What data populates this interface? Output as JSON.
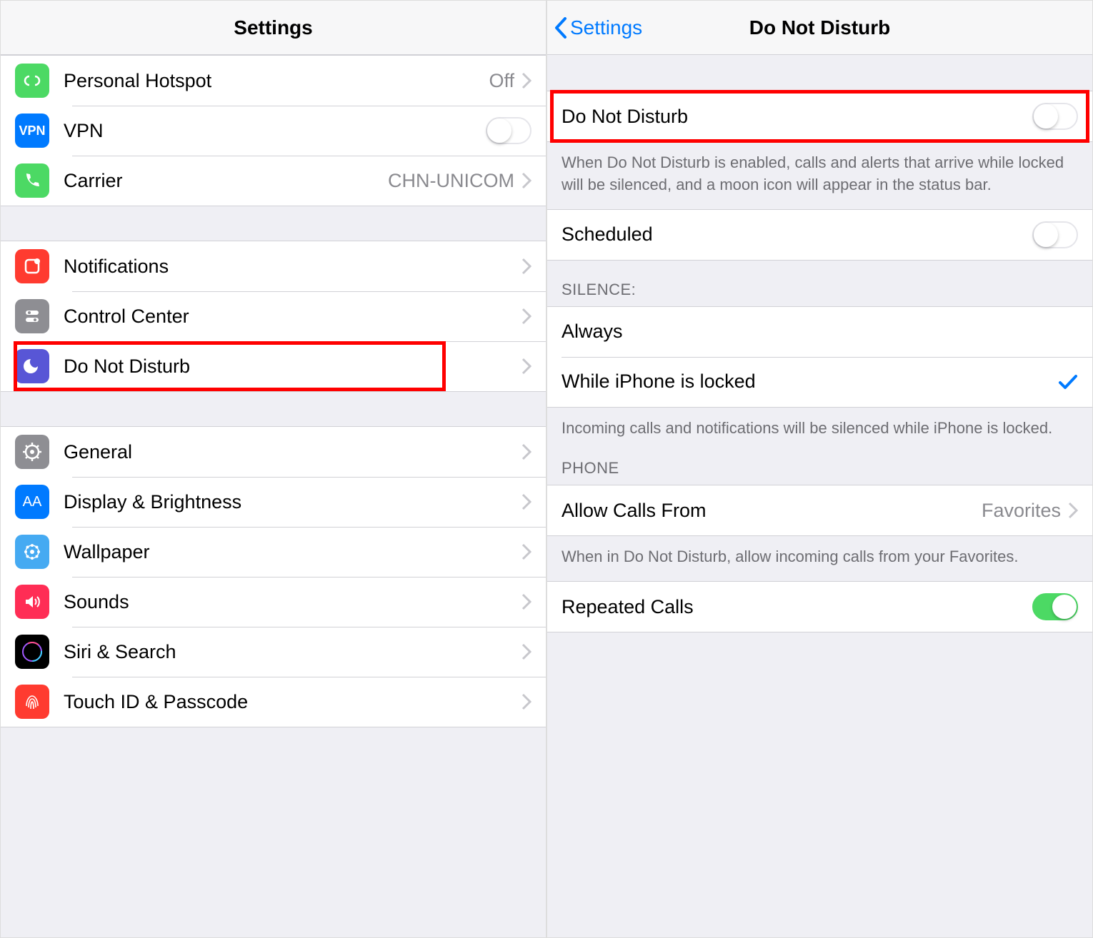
{
  "left": {
    "title": "Settings",
    "rows": {
      "hotspot": {
        "label": "Personal Hotspot",
        "value": "Off"
      },
      "vpn": {
        "label": "VPN"
      },
      "carrier": {
        "label": "Carrier",
        "value": "CHN-UNICOM"
      },
      "notifications": {
        "label": "Notifications"
      },
      "control": {
        "label": "Control Center"
      },
      "dnd": {
        "label": "Do Not Disturb"
      },
      "general": {
        "label": "General"
      },
      "display": {
        "label": "Display & Brightness"
      },
      "wallpaper": {
        "label": "Wallpaper"
      },
      "sounds": {
        "label": "Sounds"
      },
      "siri": {
        "label": "Siri & Search"
      },
      "touchid": {
        "label": "Touch ID & Passcode"
      }
    }
  },
  "right": {
    "back": "Settings",
    "title": "Do Not Disturb",
    "dnd_label": "Do Not Disturb",
    "dnd_footer": "When Do Not Disturb is enabled, calls and alerts that arrive while locked will be silenced, and a moon icon will appear in the status bar.",
    "scheduled_label": "Scheduled",
    "silence_header": "SILENCE:",
    "always_label": "Always",
    "while_locked_label": "While iPhone is locked",
    "silence_footer": "Incoming calls and notifications will be silenced while iPhone is locked.",
    "phone_header": "PHONE",
    "allow_calls_label": "Allow Calls From",
    "allow_calls_value": "Favorites",
    "allow_calls_footer": "When in Do Not Disturb, allow incoming calls from your Favorites.",
    "repeated_label": "Repeated Calls"
  }
}
